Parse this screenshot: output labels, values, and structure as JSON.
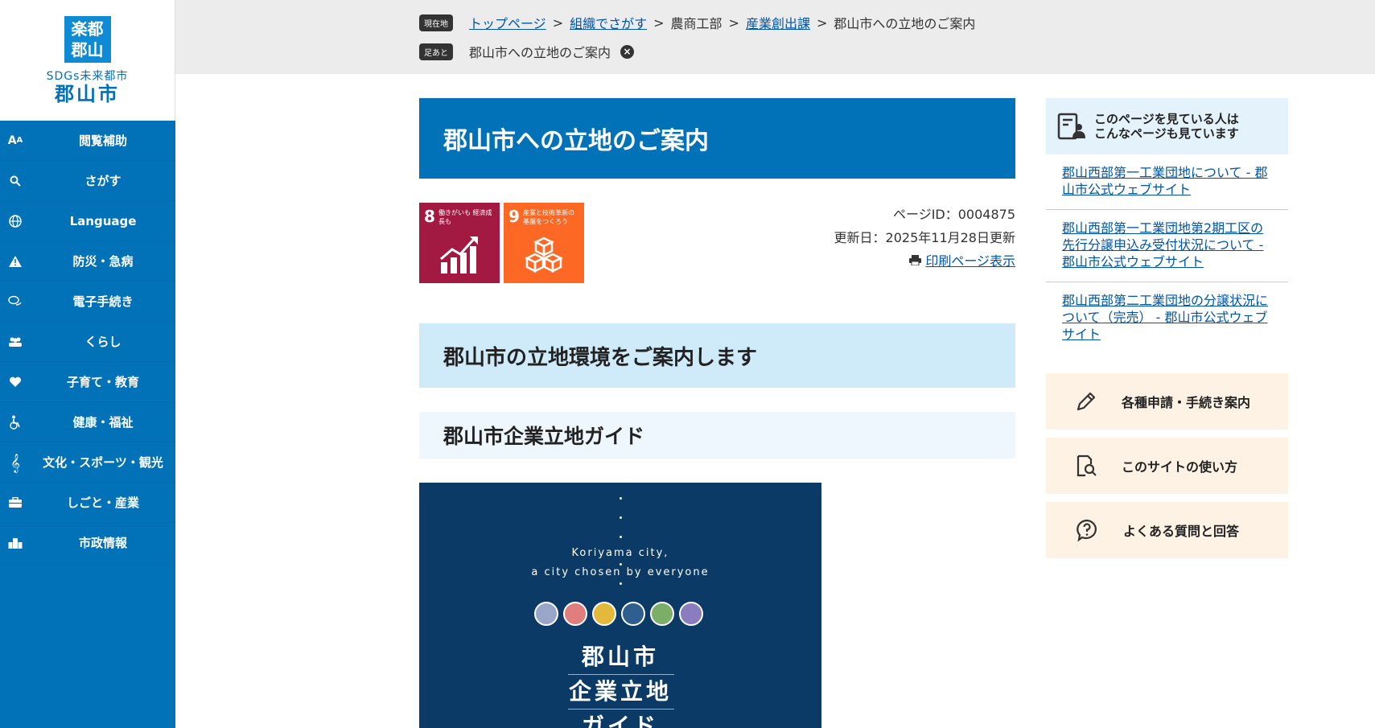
{
  "logo": {
    "mark_line1": "楽都",
    "mark_line2": "郡山",
    "tagline": "SDGs未来都市",
    "city": "郡山市"
  },
  "sidebar": {
    "items": [
      {
        "label": "閲覧補助",
        "icon": "font-size-icon"
      },
      {
        "label": "さがす",
        "icon": "search-icon"
      },
      {
        "label": "Language",
        "icon": "globe-icon"
      },
      {
        "label": "防災・急病",
        "icon": "warning-icon"
      },
      {
        "label": "電子手続き",
        "icon": "chat-icon"
      },
      {
        "label": "くらし",
        "icon": "people-icon"
      },
      {
        "label": "子育て・教育",
        "icon": "heart-icon"
      },
      {
        "label": "健康・福祉",
        "icon": "wheelchair-icon"
      },
      {
        "label": "文化・スポーツ・観光",
        "icon": "music-icon"
      },
      {
        "label": "しごと・産業",
        "icon": "briefcase-icon"
      },
      {
        "label": "市政情報",
        "icon": "building-icon"
      }
    ]
  },
  "breadcrumb": {
    "current_tag": "現在地",
    "items": [
      "トップページ",
      "組織でさがす",
      "農商工部",
      "産業創出課",
      "郡山市への立地のご案内"
    ],
    "history_tag": "足あと",
    "history_item": "郡山市への立地のご案内",
    "sep": ">"
  },
  "main": {
    "title": "郡山市への立地のご案内",
    "sdg8": {
      "num": "8",
      "text": "働きがいも 経済成長も"
    },
    "sdg9": {
      "num": "9",
      "text": "産業と技術革新の 基盤をつくろう"
    },
    "page_id": "ページID：0004875",
    "updated": "更新日：2025年11月28日更新",
    "print": "印刷ページ表示",
    "h2": "郡山市の立地環境をご案内します",
    "h3": "郡山市企業立地ガイド",
    "guide": {
      "en1": "Koriyama city,",
      "en2": "a city chosen by everyone",
      "jp1": "郡山市",
      "jp2": "企業立地",
      "jp3": "ガイド"
    }
  },
  "related": {
    "heading_line1": "このページを見ている人は",
    "heading_line2": "こんなページも見ています",
    "links": [
      "郡山西部第一工業団地について - 郡山市公式ウェブサイト",
      "郡山西部第一工業団地第2期工区の先行分譲申込み受付状況について - 郡山市公式ウェブサイト",
      "郡山西部第二工業団地の分譲状況について（完売） - 郡山市公式ウェブサイト"
    ]
  },
  "cta": [
    {
      "label": "各種申請・手続き案内",
      "icon": "pencil-icon"
    },
    {
      "label": "このサイトの使い方",
      "icon": "document-search-icon"
    },
    {
      "label": "よくある質問と回答",
      "icon": "question-bubble-icon"
    }
  ],
  "colors": {
    "brand_blue": "#0171b8",
    "sdg8": "#a21942",
    "sdg9": "#fd6925"
  }
}
